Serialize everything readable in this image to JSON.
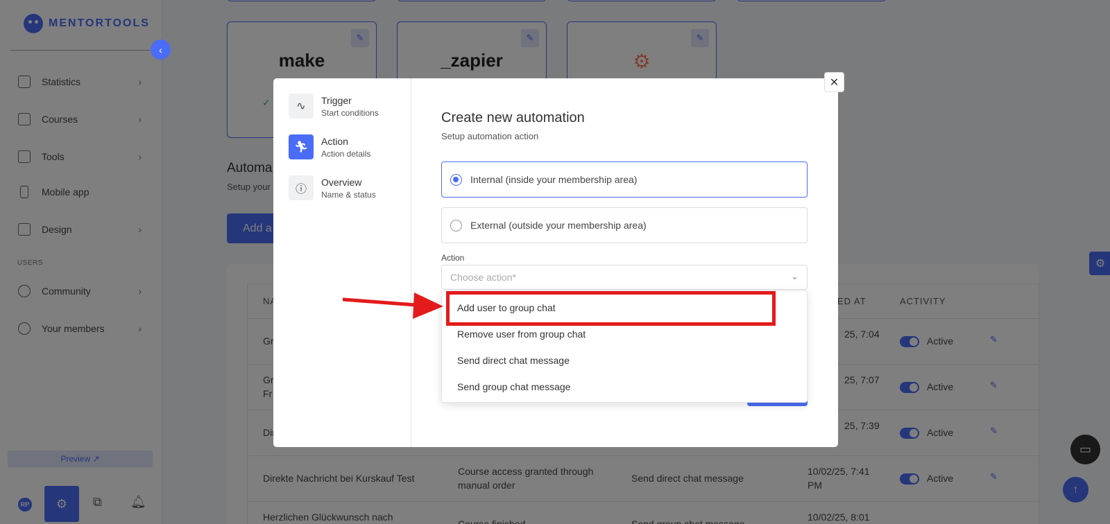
{
  "app": {
    "logo_text": "MENTORTOOLS",
    "accent_color": "#4a6cf7"
  },
  "sidebar": {
    "collapse_icon": "chevron-left-icon",
    "items": [
      {
        "label": "Statistics",
        "icon": "bar-chart-icon"
      },
      {
        "label": "Courses",
        "icon": "book-icon"
      },
      {
        "label": "Tools",
        "icon": "megaphone-icon"
      },
      {
        "label": "Mobile app",
        "icon": "mobile-icon"
      },
      {
        "label": "Design",
        "icon": "brush-icon"
      }
    ],
    "section_users": "USERS",
    "user_items": [
      {
        "label": "Community",
        "icon": "community-icon"
      },
      {
        "label": "Your members",
        "icon": "user-icon"
      }
    ],
    "preview_label": "Preview ↗",
    "avatar_initials": "RP"
  },
  "integrations": [
    {
      "brand": "make"
    },
    {
      "brand": "_zapier"
    },
    {
      "brand": "hubspot"
    }
  ],
  "automations": {
    "title": "Automa",
    "subtitle": "Setup your",
    "add_button": "Add a",
    "headers": {
      "name": "NA",
      "created": "TED AT",
      "activity": "ACTIVITY"
    },
    "rows": [
      {
        "name": "Gr",
        "trigger": "",
        "action": "",
        "created": "25, 7:04",
        "created2": "",
        "status": "Active"
      },
      {
        "name": "Gr",
        "name2": "Fr",
        "trigger": "",
        "action": "",
        "created": "25, 7:07",
        "created2": "",
        "status": "Active"
      },
      {
        "name": "Dir",
        "trigger": "",
        "action": "",
        "created": "25, 7:39",
        "created2": "",
        "status": "Active"
      },
      {
        "name": "Direkte Nachricht bei Kurskauf Test",
        "trigger": "Course access granted through",
        "trigger2": "manual order",
        "action": "Send direct chat message",
        "created": "10/02/25, 7:41",
        "created2": "PM",
        "status": "Active"
      },
      {
        "name": "Herzlichen Glückwunsch nach",
        "trigger": "Course finished",
        "action": "Send group chat message",
        "created": "10/02/25, 8:01",
        "created2": "",
        "status": ""
      }
    ]
  },
  "modal": {
    "steps": [
      {
        "title": "Trigger",
        "subtitle": "Start conditions",
        "icon": "pulse-icon"
      },
      {
        "title": "Action",
        "subtitle": "Action details",
        "icon": "running-person-icon"
      },
      {
        "title": "Overview",
        "subtitle": "Name & status",
        "icon": "info-icon"
      }
    ],
    "title": "Create new automation",
    "subtitle": "Setup automation action",
    "options": {
      "internal": "Internal (inside your membership area)",
      "external": "External (outside your membership area)"
    },
    "action_label": "Action",
    "action_placeholder": "Choose action*",
    "dropdown": [
      "Add user to group chat",
      "Remove user from group chat",
      "Send direct chat message",
      "Send group chat message"
    ]
  },
  "annotation_color": "#e31b1b"
}
